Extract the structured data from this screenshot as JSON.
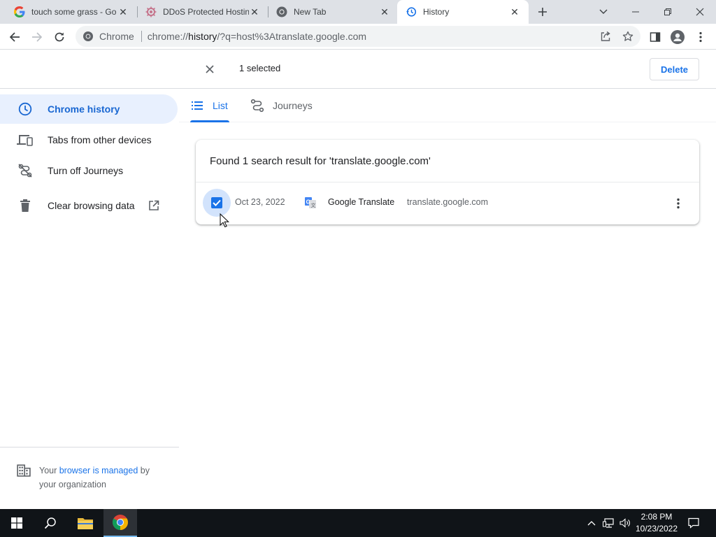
{
  "browser": {
    "tabs": [
      {
        "title": "touch some grass - Go",
        "favicon": "google-g-icon"
      },
      {
        "title": "DDoS Protected Hostin",
        "favicon": "ddos-site-icon"
      },
      {
        "title": "New Tab",
        "favicon": "chrome-icon"
      },
      {
        "title": "History",
        "favicon": "history-icon"
      }
    ],
    "omnibox": {
      "site_label": "Chrome",
      "url_prefix": "chrome://",
      "url_host": "history",
      "url_rest": "/?q=host%3Atranslate.google.com"
    }
  },
  "history": {
    "selection": {
      "count_label": "1 selected",
      "delete_label": "Delete"
    },
    "sidebar": {
      "items": [
        {
          "label": "Chrome history",
          "icon": "clock-icon"
        },
        {
          "label": "Tabs from other devices",
          "icon": "devices-icon"
        },
        {
          "label": "Turn off Journeys",
          "icon": "journeys-off-icon"
        },
        {
          "label": "Clear browsing data",
          "icon": "trash-icon"
        }
      ],
      "managed": {
        "prefix": "Your ",
        "link": "browser is managed",
        "suffix": " by",
        "line2": "your organization"
      }
    },
    "view_tabs": [
      {
        "label": "List",
        "icon": "list-icon"
      },
      {
        "label": "Journeys",
        "icon": "journeys-icon"
      }
    ],
    "results": {
      "heading": "Found 1 search result for 'translate.google.com'",
      "entries": [
        {
          "date": "Oct 23, 2022",
          "title": "Google Translate",
          "domain": "translate.google.com",
          "checked": true,
          "favicon": "google-translate-icon"
        }
      ]
    }
  },
  "taskbar": {
    "time": "2:08 PM",
    "date": "10/23/2022"
  },
  "colors": {
    "accent": "#1a73e8",
    "selected_bg": "#e8f0fe",
    "tabstrip": "#dee1e6",
    "taskbar": "#101418"
  }
}
